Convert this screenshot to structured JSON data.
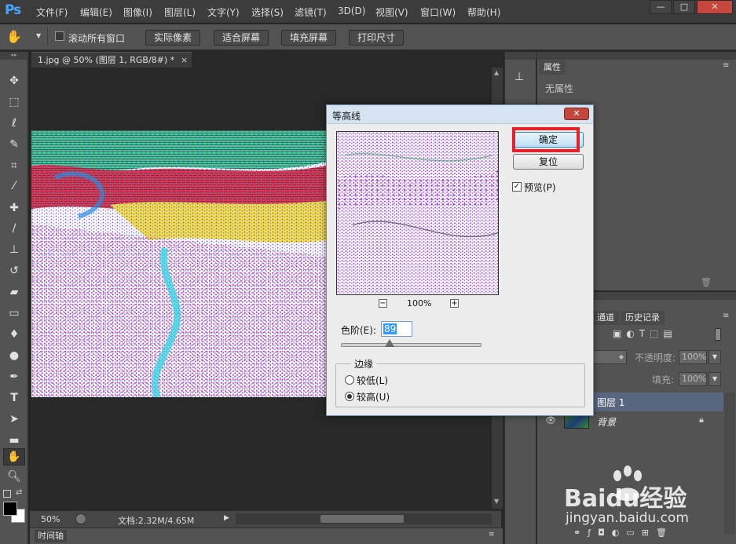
{
  "app": {
    "logo": "Ps"
  },
  "menu": [
    "文件(F)",
    "编辑(E)",
    "图像(I)",
    "图层(L)",
    "文字(Y)",
    "选择(S)",
    "滤镜(T)",
    "3D(D)",
    "视图(V)",
    "窗口(W)",
    "帮助(H)"
  ],
  "window_controls": {
    "minimize": "—",
    "maximize": "□",
    "close": "✕"
  },
  "options_bar": {
    "scroll_all": "滚动所有窗口",
    "buttons": [
      "实际像素",
      "适合屏幕",
      "填充屏幕",
      "打印尺寸"
    ]
  },
  "document": {
    "tab_title": "1.jpg @ 50% (图层 1, RGB/8#) *",
    "tab_close": "×",
    "zoom": "50%",
    "doc_info": "文档:2.32M/4.65M"
  },
  "timeline": {
    "label": "时间轴"
  },
  "properties_panel": {
    "tab": "属性",
    "empty_text": "无属性"
  },
  "layers_panel": {
    "tabs": [
      "通道",
      "历史记录"
    ],
    "opacity_label": "不透明度:",
    "opacity_value": "100%",
    "fill_label": "填充:",
    "fill_value": "100%",
    "layers": [
      {
        "name": "图层 1",
        "selected": true
      },
      {
        "name": "背景",
        "selected": false,
        "locked": true
      }
    ]
  },
  "dialog": {
    "title": "等高线",
    "close": "✕",
    "ok_label": "确定",
    "reset_label": "复位",
    "preview_label": "预览(P)",
    "preview_checked": true,
    "zoom_out": "−",
    "zoom_in": "+",
    "zoom_value": "100%",
    "level_label": "色阶(E):",
    "level_value": "89",
    "level_min": 0,
    "level_max": 255,
    "edge_group": "边缘",
    "edge_options": [
      "较低(L)",
      "较高(U)"
    ],
    "edge_selected": 1
  },
  "watermark": {
    "brand_text": "Baidu经验",
    "url": "jingyan.baidu.com"
  }
}
